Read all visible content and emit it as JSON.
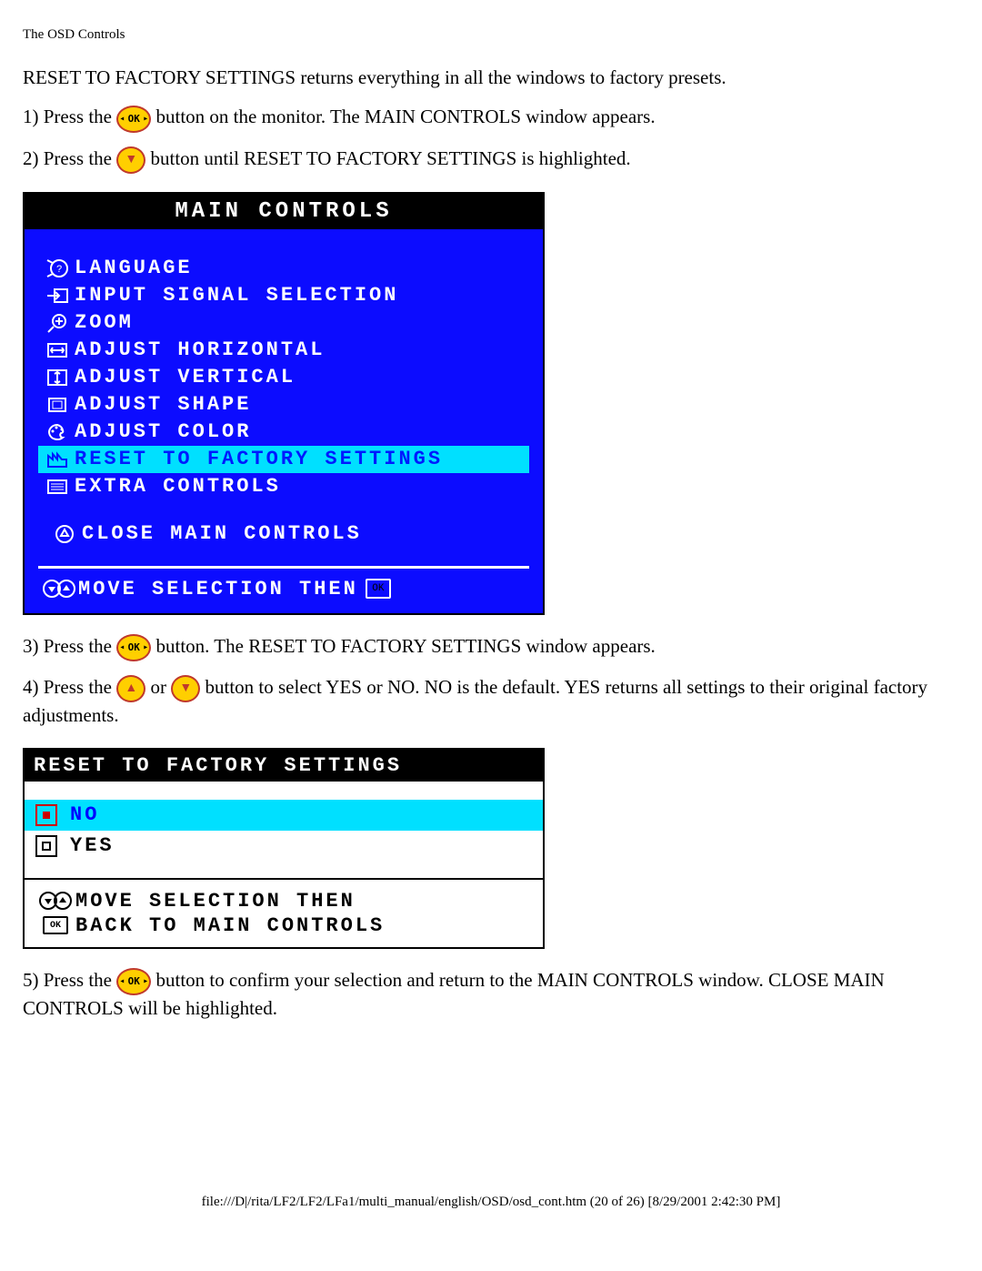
{
  "header": {
    "title": "The OSD Controls"
  },
  "intro": "RESET TO FACTORY SETTINGS returns everything in all the windows to factory presets.",
  "step1_a": "1) Press the ",
  "step1_b": " button on the monitor. The MAIN CONTROLS window appears.",
  "step2_a": "2) Press the ",
  "step2_b": " button until RESET TO FACTORY SETTINGS is highlighted.",
  "osd": {
    "title": "MAIN CONTROLS",
    "items": [
      {
        "label": "LANGUAGE"
      },
      {
        "label": "INPUT SIGNAL SELECTION"
      },
      {
        "label": "ZOOM"
      },
      {
        "label": "ADJUST HORIZONTAL"
      },
      {
        "label": "ADJUST VERTICAL"
      },
      {
        "label": "ADJUST SHAPE"
      },
      {
        "label": "ADJUST COLOR"
      },
      {
        "label": "RESET TO FACTORY SETTINGS"
      },
      {
        "label": "EXTRA CONTROLS"
      }
    ],
    "close": "CLOSE MAIN CONTROLS",
    "footer_text": "MOVE SELECTION THEN",
    "footer_ok": "OK"
  },
  "step3_a": "3) Press the ",
  "step3_b": " button. The RESET TO FACTORY SETTINGS window appears.",
  "step4_a": "4) Press the ",
  "step4_or": " or ",
  "step4_b": " button to select YES or NO. NO is the default. YES returns all settings to their original factory adjustments.",
  "reset": {
    "title": "RESET TO FACTORY SETTINGS",
    "no": "NO",
    "yes": "YES",
    "move": "MOVE SELECTION THEN",
    "back": "BACK TO MAIN CONTROLS",
    "ok": "OK"
  },
  "step5_a": "5) Press the ",
  "step5_b": " button to confirm your selection and return to the MAIN CONTROLS window. CLOSE MAIN CONTROLS will be highlighted.",
  "footer_path": "file:///D|/rita/LF2/LF2/LFa1/multi_manual/english/OSD/osd_cont.htm (20 of 26) [8/29/2001 2:42:30 PM]"
}
